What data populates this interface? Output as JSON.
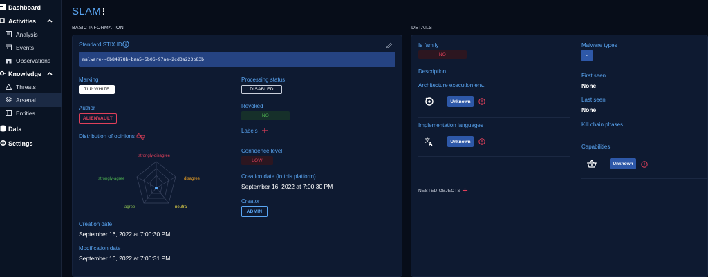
{
  "sidebar": {
    "dashboard": "Dashboard",
    "activities": "Activities",
    "analysis": "Analysis",
    "events": "Events",
    "observations": "Observations",
    "knowledge": "Knowledge",
    "threats": "Threats",
    "arsenal": "Arsenal",
    "entities": "Entities",
    "data": "Data",
    "settings": "Settings"
  },
  "header": {
    "title": "SLAM"
  },
  "basic": {
    "section_title": "BASIC INFORMATION",
    "stix_label": "Standard STIX ID",
    "stix_value": "malware--0b84978b-baa5-5b06-97ae-2cd3a223b83b",
    "marking_label": "Marking",
    "marking_value": "TLP:WHITE",
    "author_label": "Author",
    "author_value": "ALIENVAULT",
    "opinions_label": "Distribution of opinions",
    "radar": {
      "strongly_disagree": "strongly-disagree",
      "disagree": "disagree",
      "neutral": "neutral",
      "agree": "agree",
      "strongly_agree": "strongly-agree"
    },
    "creation_label": "Creation date",
    "creation_value": "September 16, 2022 at 7:00:30 PM",
    "modification_label": "Modification date",
    "modification_value": "September 16, 2022 at 7:00:31 PM",
    "processing_label": "Processing status",
    "processing_value": "DISABLED",
    "revoked_label": "Revoked",
    "revoked_value": "NO",
    "labels_label": "Labels",
    "confidence_label": "Confidence level",
    "confidence_value": "LOW",
    "platform_creation_label": "Creation date (in this platform)",
    "platform_creation_value": "September 16, 2022 at 7:00:30 PM",
    "creator_label": "Creator",
    "creator_value": "ADMIN"
  },
  "details": {
    "section_title": "DETAILS",
    "is_family_label": "Is family",
    "is_family_value": "NO",
    "description_label": "Description",
    "arch_label": "Architecture execution env.",
    "arch_value": "Unknown",
    "impl_label": "Implementation languages",
    "impl_value": "Unknown",
    "malware_types_label": "Malware types",
    "malware_types_value": "-",
    "first_seen_label": "First seen",
    "first_seen_value": "None",
    "last_seen_label": "Last seen",
    "last_seen_value": "None",
    "kill_chain_label": "Kill chain phases",
    "capabilities_label": "Capabilities",
    "capabilities_value": "Unknown",
    "nested_label": "NESTED OBJECTS"
  },
  "colors": {
    "accent": "#5aa6f3",
    "danger": "#e0405a",
    "success": "#4caf50",
    "orange": "#f5a623"
  }
}
